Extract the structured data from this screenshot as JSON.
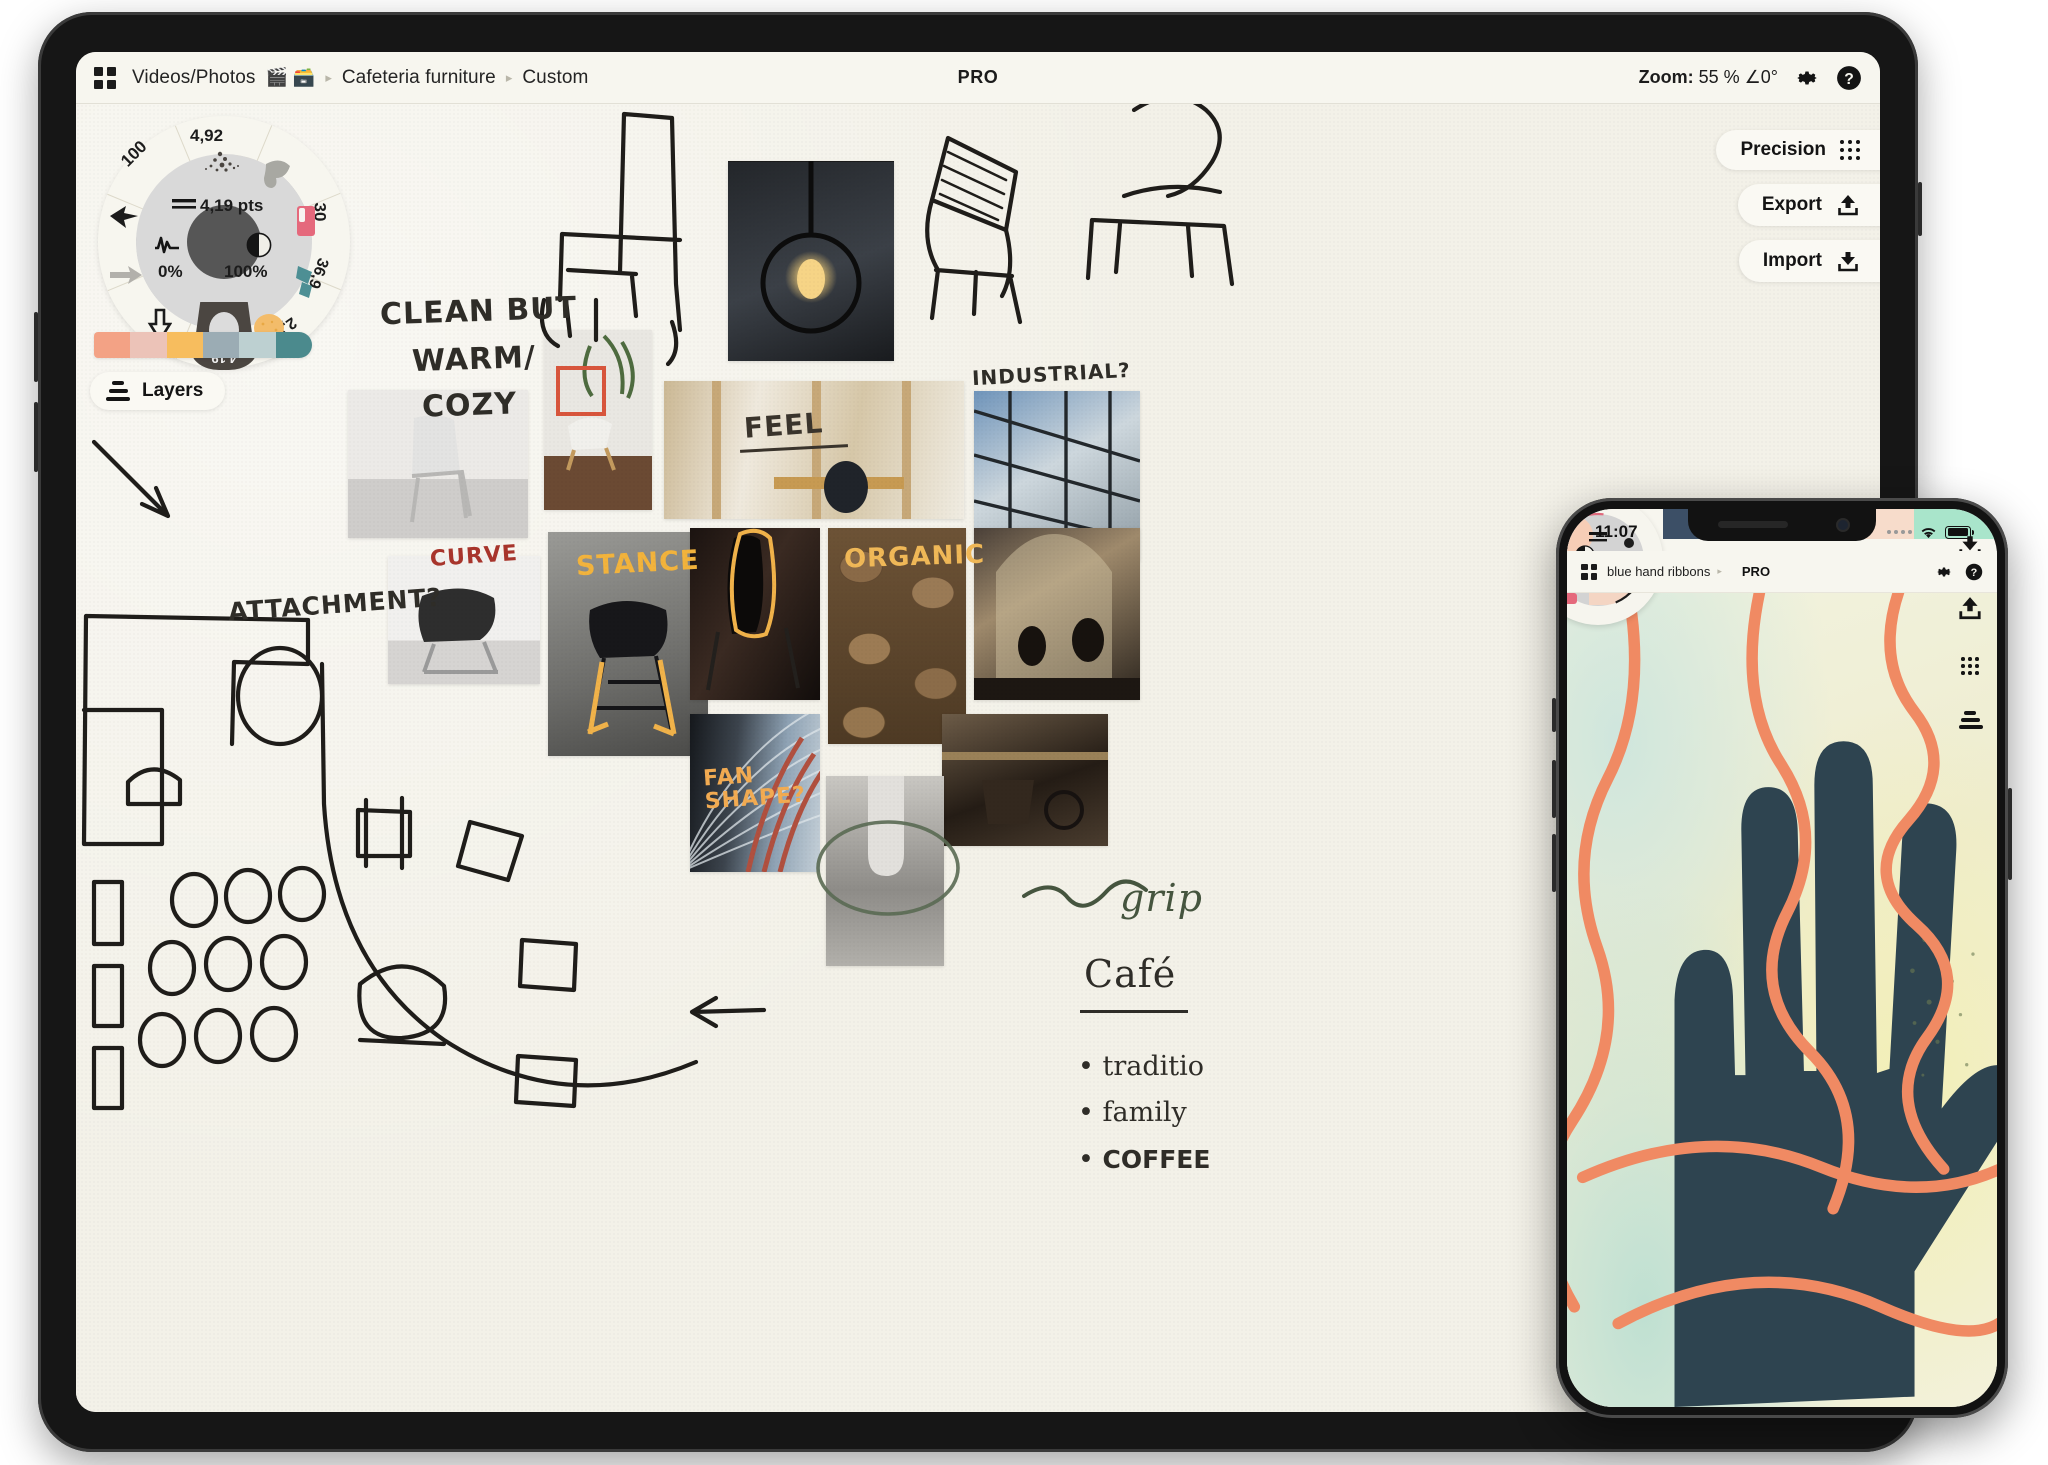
{
  "tablet": {
    "topbar": {
      "apps_icon": "grid-icon",
      "breadcrumbs": [
        {
          "label": "Videos/Photos",
          "emoji": "🎬 🗃️"
        },
        {
          "label": "Cafeteria furniture",
          "emoji": ""
        },
        {
          "label": "Custom",
          "emoji": ""
        }
      ],
      "separator": "▸",
      "pro_badge": "PRO",
      "zoom_label": "Zoom:",
      "zoom_value": "55 %",
      "angle_value": "∠0°",
      "settings_icon": "gear-icon",
      "help_icon": "help-icon"
    },
    "tool_wheel": {
      "center_size_label": "4,19 pts",
      "min_label": "0%",
      "max_label": "100%",
      "segments": [
        {
          "label": "4,92",
          "icon": "spray-brush-icon"
        },
        {
          "label": "",
          "icon": "eraser-icon"
        },
        {
          "label": "30",
          "icon": "marker-icon"
        },
        {
          "label": "36,9",
          "icon": "paint-bucket-icon"
        },
        {
          "label": "2,81",
          "icon": "sponge-icon"
        },
        {
          "label": "4,19",
          "icon": "soft-brush-icon"
        },
        {
          "label": "",
          "icon": "redo-arrow-icon"
        },
        {
          "label": "100",
          "icon": "undo-arrow-icon"
        }
      ],
      "inner_icons": [
        {
          "icon": "opacity-icon"
        },
        {
          "icon": "pressure-curve-icon"
        },
        {
          "icon": "size-lines-icon"
        }
      ]
    },
    "palette": {
      "swatches": [
        "#f3a285",
        "#ecc3b8",
        "#f7bd5e",
        "#9bacb4",
        "#bdd0d1",
        "#4b8a8d"
      ]
    },
    "layers_button": {
      "label": "Layers",
      "icon": "layers-icon"
    },
    "actions": [
      {
        "label": "Precision",
        "icon": "dots-grid-icon"
      },
      {
        "label": "Export",
        "icon": "upload-icon"
      },
      {
        "label": "Import",
        "icon": "download-icon"
      }
    ],
    "canvas_notes": [
      {
        "id": "clean-but",
        "text": "CLEAN BUT",
        "color": "#2f2d28"
      },
      {
        "id": "warm-slash",
        "text": "WARM/",
        "color": "#2f2d28"
      },
      {
        "id": "cozy",
        "text": "COZY",
        "color": "#2f2d28"
      },
      {
        "id": "attachment",
        "text": "ATTACHMENT?",
        "color": "#2f2d28"
      },
      {
        "id": "feel",
        "text": "FEEL",
        "color": "#3a342c"
      },
      {
        "id": "industrial",
        "text": "INDUSTRIAL?",
        "color": "#2f2d28"
      },
      {
        "id": "curve",
        "text": "CURVE",
        "color": "#a8352c"
      },
      {
        "id": "stance",
        "text": "STANCE",
        "color": "#f2b33c"
      },
      {
        "id": "organic",
        "text": "ORGANIC",
        "color": "#f0b857"
      },
      {
        "id": "fan-shape",
        "text": "FAN\nSHAPE?",
        "color": "#f2ab52"
      },
      {
        "id": "grip",
        "text": "grip",
        "color": "#46553f"
      },
      {
        "id": "cafe",
        "text": "Café",
        "color": "#2f2d28"
      }
    ],
    "cafe_bullets": [
      {
        "text": "traditio"
      },
      {
        "text": "family"
      },
      {
        "text": "COFFEE"
      }
    ]
  },
  "phone": {
    "status": {
      "time": "11:07",
      "wifi_icon": "wifi-icon",
      "battery_icon": "battery-icon",
      "signal_icon": "signal-dots-icon"
    },
    "topbar": {
      "apps_icon": "grid-icon",
      "title": "blue hand ribbons",
      "separator": "▸",
      "pro_badge": "PRO",
      "settings_icon": "gear-icon",
      "help_icon": "help-icon"
    },
    "palette": {
      "swatches": [
        "#3c4f66",
        "#6f93cb",
        "#f7dccb",
        "#a9e5cb"
      ]
    },
    "right_icons": [
      {
        "icon": "download-icon",
        "name": "import"
      },
      {
        "icon": "upload-icon",
        "name": "export"
      },
      {
        "icon": "dots-grid-icon",
        "name": "precision"
      },
      {
        "icon": "layers-icon",
        "name": "layers"
      }
    ],
    "artwork": {
      "name": "blue hand with orange ribbons",
      "ribbon_color": "#f08a63",
      "hand_color": "#2e4450"
    }
  }
}
